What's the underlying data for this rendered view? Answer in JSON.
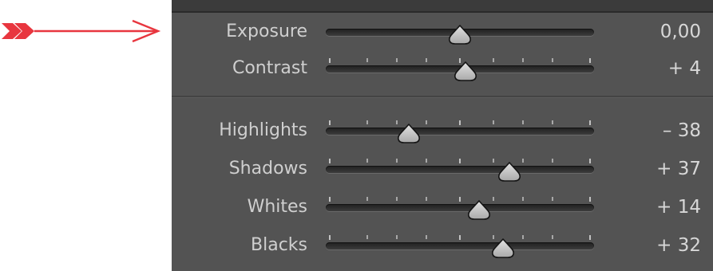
{
  "panel": {
    "sliders": [
      {
        "label": "Exposure",
        "value_text": "0,00",
        "position": 0.5,
        "ticks": false
      },
      {
        "label": "Contrast",
        "value_text": "+ 4",
        "position": 0.52,
        "ticks": true
      },
      {
        "label": "Highlights",
        "value_text": "– 38",
        "position": 0.31,
        "ticks": true
      },
      {
        "label": "Shadows",
        "value_text": "+ 37",
        "position": 0.685,
        "ticks": true
      },
      {
        "label": "Whites",
        "value_text": "+ 14",
        "position": 0.57,
        "ticks": true
      },
      {
        "label": "Blacks",
        "value_text": "+ 32",
        "position": 0.66,
        "ticks": true
      }
    ]
  },
  "colors": {
    "annotation_arrow": "#e8363f",
    "panel_background": "#535353",
    "label_text": "#cfcfcf"
  },
  "icons": {
    "annotation": "double-chevron-arrow-right-icon",
    "slider_handle": "slider-knob-icon"
  }
}
